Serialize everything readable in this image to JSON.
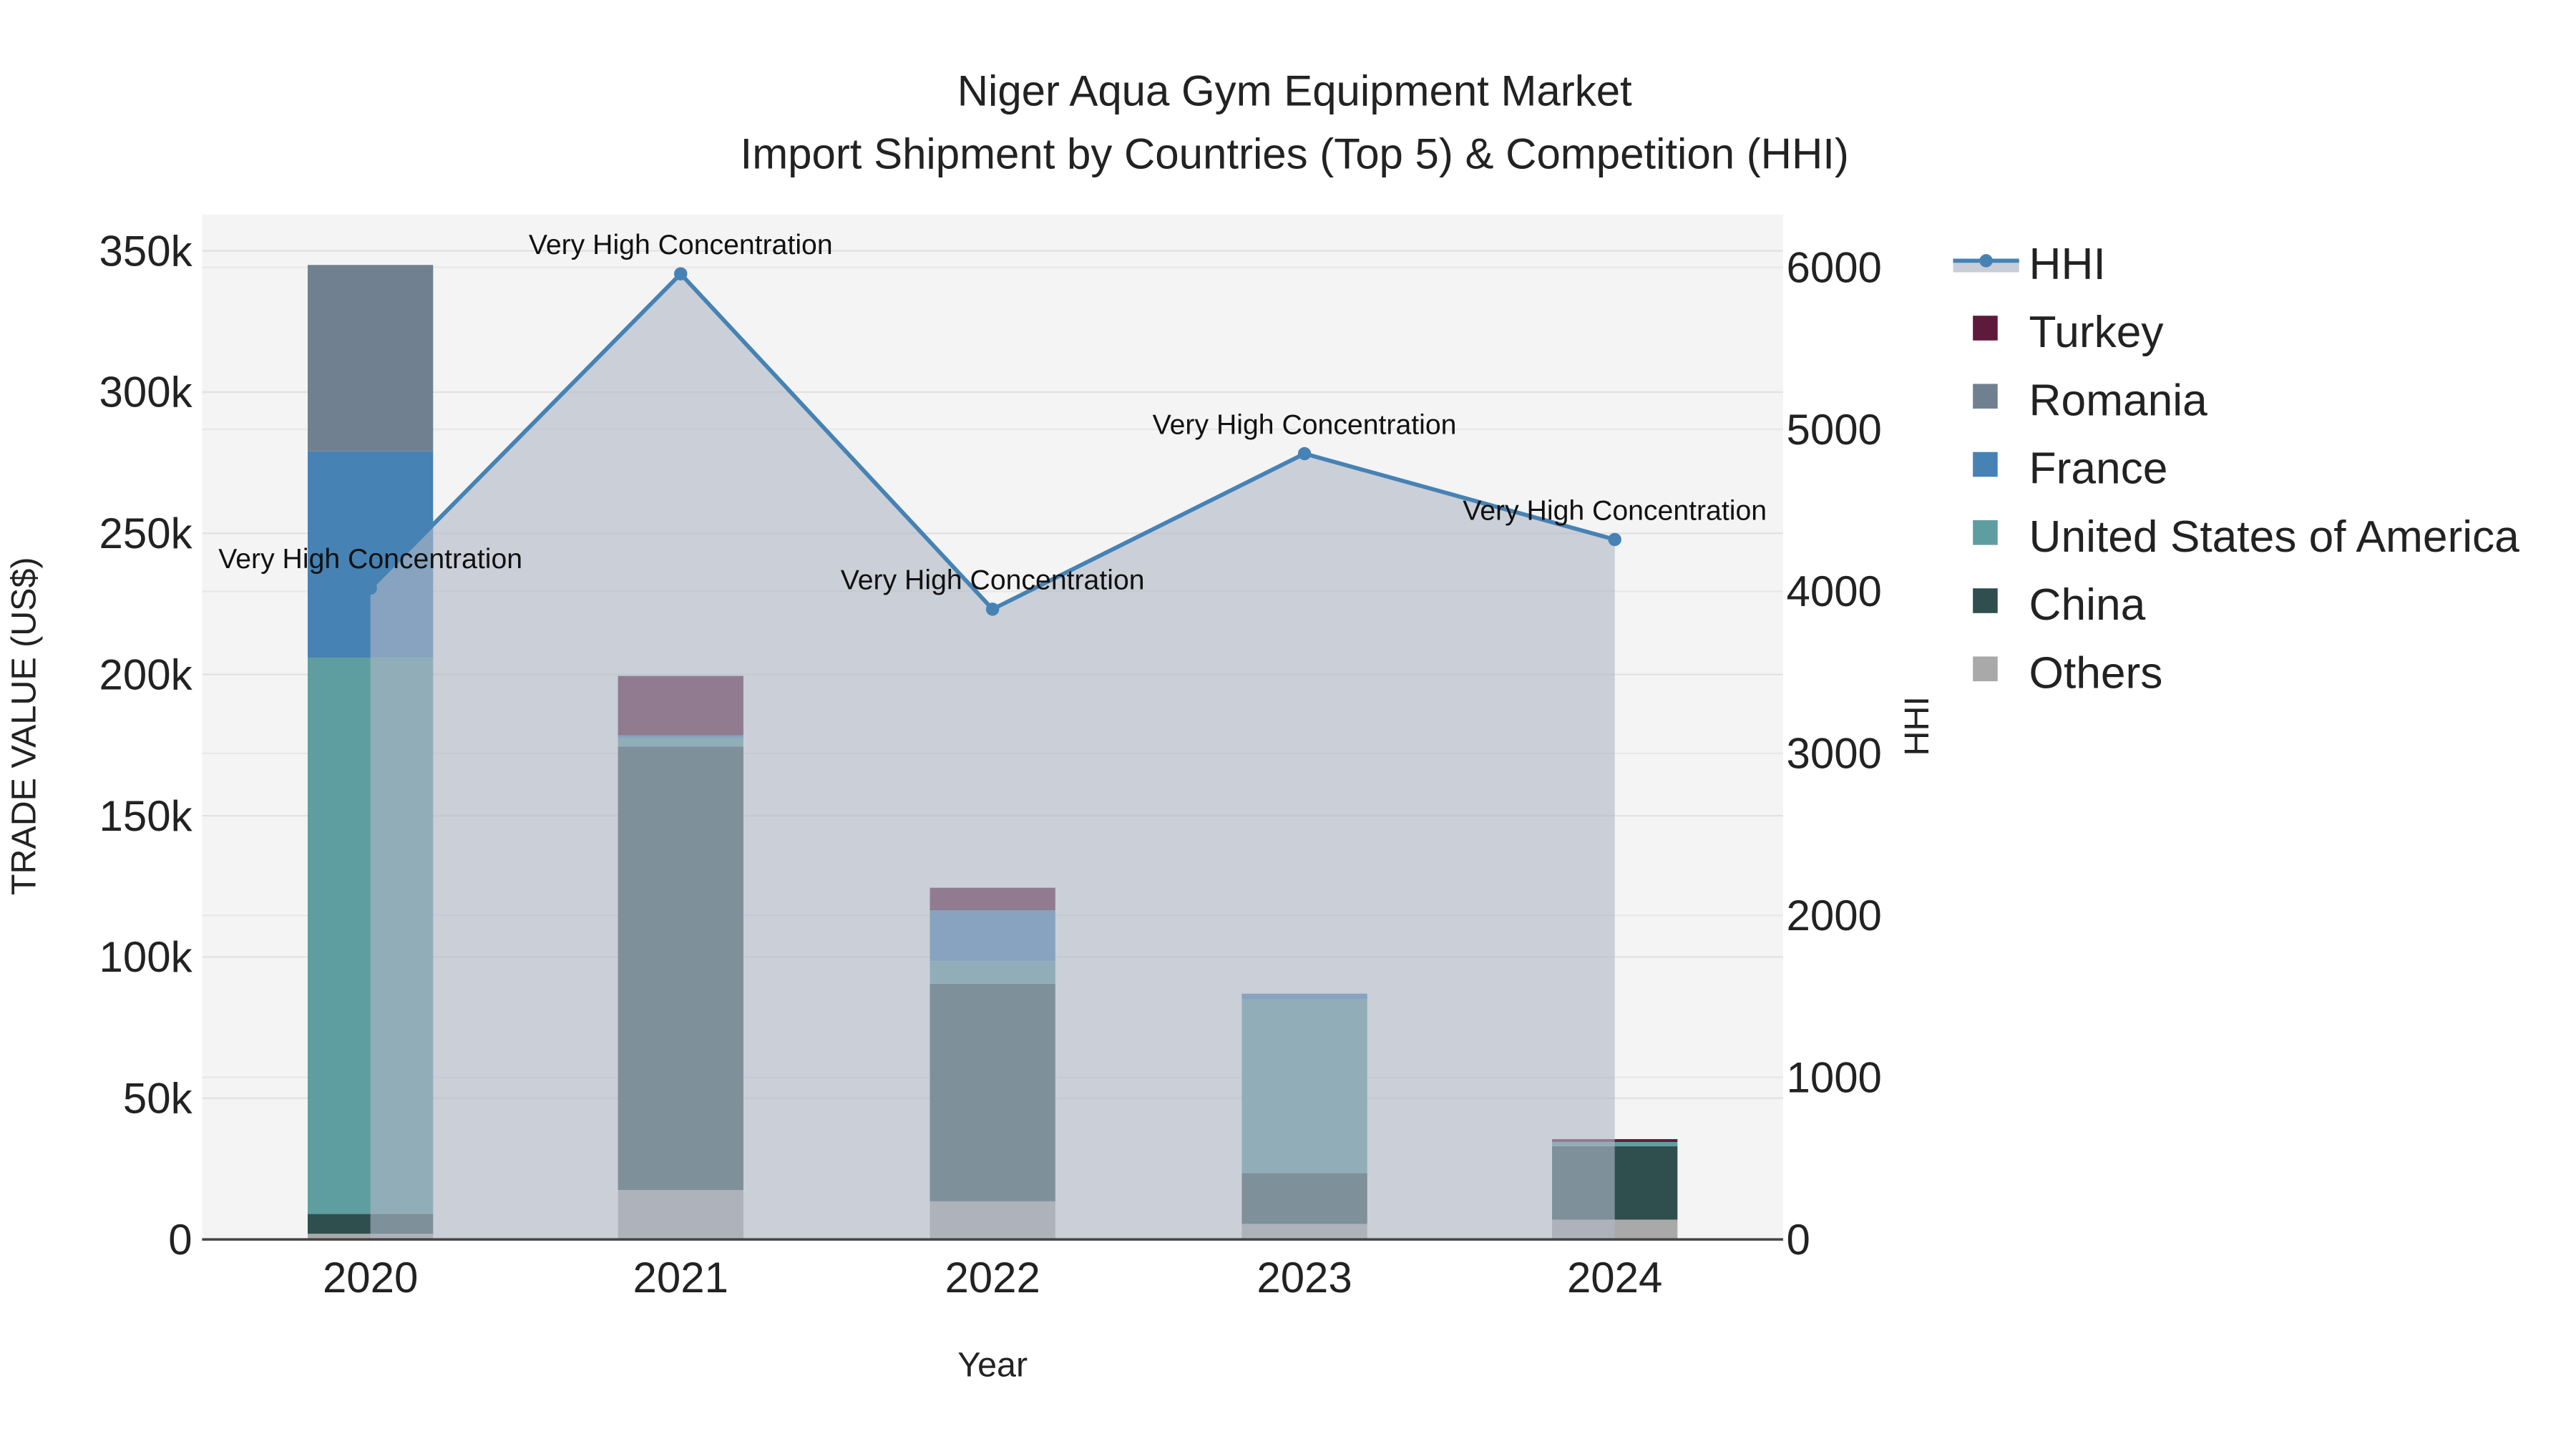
{
  "chart_data": {
    "type": "bar",
    "title": "Niger Aqua Gym Equipment Market",
    "subtitle": "Import Shipment by Countries (Top 5) & Competition (HHI)",
    "xlabel": "Year",
    "ylabel": "TRADE VALUE (US$)",
    "y2label": "HHI",
    "categories": [
      "2020",
      "2021",
      "2022",
      "2023",
      "2024"
    ],
    "ylim": [
      0,
      362000
    ],
    "y2lim": [
      0,
      6300
    ],
    "yticks": [
      0,
      50000,
      100000,
      150000,
      200000,
      250000,
      300000,
      350000
    ],
    "ytick_labels": [
      "0",
      "50k",
      "100k",
      "150k",
      "200k",
      "250k",
      "300k",
      "350k"
    ],
    "y2ticks": [
      0,
      1000,
      2000,
      3000,
      4000,
      5000,
      6000
    ],
    "y2tick_labels": [
      "0",
      "1000",
      "2000",
      "3000",
      "4000",
      "5000",
      "6000"
    ],
    "stacked": true,
    "series": [
      {
        "name": "Others",
        "color": "#a9a9a9",
        "values": [
          2000,
          17500,
          13500,
          5500,
          7000
        ]
      },
      {
        "name": "China",
        "color": "#2f4f4f",
        "values": [
          7000,
          157000,
          77000,
          18000,
          26000
        ]
      },
      {
        "name": "United States of America",
        "color": "#5f9ea0",
        "values": [
          197000,
          3000,
          8000,
          61500,
          1500
        ]
      },
      {
        "name": "France",
        "color": "#4682b4",
        "values": [
          73000,
          1000,
          18000,
          2000,
          0
        ]
      },
      {
        "name": "Romania",
        "color": "#708090",
        "values": [
          66000,
          0,
          0,
          0,
          0
        ]
      },
      {
        "name": "Turkey",
        "color": "#5e1a3b",
        "values": [
          0,
          21000,
          8000,
          0,
          1000
        ]
      }
    ],
    "hhi": {
      "name": "HHI",
      "color": "#4682b4",
      "values": [
        4020,
        5960,
        3890,
        4850,
        4320
      ],
      "annotations": [
        "Very High Concentration",
        "Very High Concentration",
        "Very High Concentration",
        "Very High Concentration",
        "Very High Concentration"
      ]
    },
    "legend": [
      "HHI",
      "Turkey",
      "Romania",
      "France",
      "United States of America",
      "China",
      "Others"
    ],
    "legend_position": "right",
    "grid": true
  }
}
